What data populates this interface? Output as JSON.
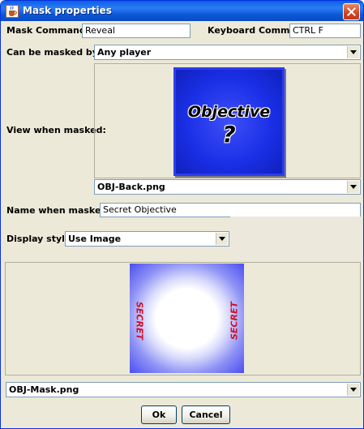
{
  "window": {
    "title": "Mask properties"
  },
  "form": {
    "mask_command_label": "Mask Command:",
    "mask_command_value": "Reveal",
    "keyboard_command_label": "Keyboard Command:",
    "keyboard_command_value": "CTRL F",
    "masked_by_label": "Can be masked by:",
    "masked_by_value": "Any player",
    "view_when_masked_label": "View when masked:",
    "view_image_file": "OBJ-Back.png",
    "view_image_text1": "Objective",
    "view_image_text2": "?",
    "name_when_masked_label": "Name when masked:",
    "name_when_masked_value": "Secret Objective",
    "display_style_label": "Display style:",
    "display_style_value": "Use Image",
    "mask_image_file": "OBJ-Mask.png",
    "mask_image_text": "SECRET"
  },
  "buttons": {
    "ok": "Ok",
    "cancel": "Cancel"
  },
  "colors": {
    "titlebar": "#0a5fe9",
    "close": "#d4431c",
    "objective_bg": "#1a2fe6",
    "mask_edge": "#4a4ff0",
    "secret_red": "#d0102a"
  }
}
